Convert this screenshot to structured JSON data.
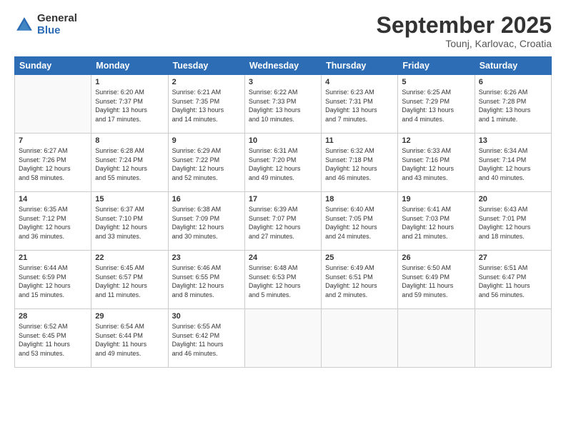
{
  "logo": {
    "general": "General",
    "blue": "Blue"
  },
  "header": {
    "month": "September 2025",
    "location": "Tounj, Karlovac, Croatia"
  },
  "weekdays": [
    "Sunday",
    "Monday",
    "Tuesday",
    "Wednesday",
    "Thursday",
    "Friday",
    "Saturday"
  ],
  "weeks": [
    [
      {
        "day": "",
        "text": ""
      },
      {
        "day": "1",
        "text": "Sunrise: 6:20 AM\nSunset: 7:37 PM\nDaylight: 13 hours\nand 17 minutes."
      },
      {
        "day": "2",
        "text": "Sunrise: 6:21 AM\nSunset: 7:35 PM\nDaylight: 13 hours\nand 14 minutes."
      },
      {
        "day": "3",
        "text": "Sunrise: 6:22 AM\nSunset: 7:33 PM\nDaylight: 13 hours\nand 10 minutes."
      },
      {
        "day": "4",
        "text": "Sunrise: 6:23 AM\nSunset: 7:31 PM\nDaylight: 13 hours\nand 7 minutes."
      },
      {
        "day": "5",
        "text": "Sunrise: 6:25 AM\nSunset: 7:29 PM\nDaylight: 13 hours\nand 4 minutes."
      },
      {
        "day": "6",
        "text": "Sunrise: 6:26 AM\nSunset: 7:28 PM\nDaylight: 13 hours\nand 1 minute."
      }
    ],
    [
      {
        "day": "7",
        "text": "Sunrise: 6:27 AM\nSunset: 7:26 PM\nDaylight: 12 hours\nand 58 minutes."
      },
      {
        "day": "8",
        "text": "Sunrise: 6:28 AM\nSunset: 7:24 PM\nDaylight: 12 hours\nand 55 minutes."
      },
      {
        "day": "9",
        "text": "Sunrise: 6:29 AM\nSunset: 7:22 PM\nDaylight: 12 hours\nand 52 minutes."
      },
      {
        "day": "10",
        "text": "Sunrise: 6:31 AM\nSunset: 7:20 PM\nDaylight: 12 hours\nand 49 minutes."
      },
      {
        "day": "11",
        "text": "Sunrise: 6:32 AM\nSunset: 7:18 PM\nDaylight: 12 hours\nand 46 minutes."
      },
      {
        "day": "12",
        "text": "Sunrise: 6:33 AM\nSunset: 7:16 PM\nDaylight: 12 hours\nand 43 minutes."
      },
      {
        "day": "13",
        "text": "Sunrise: 6:34 AM\nSunset: 7:14 PM\nDaylight: 12 hours\nand 40 minutes."
      }
    ],
    [
      {
        "day": "14",
        "text": "Sunrise: 6:35 AM\nSunset: 7:12 PM\nDaylight: 12 hours\nand 36 minutes."
      },
      {
        "day": "15",
        "text": "Sunrise: 6:37 AM\nSunset: 7:10 PM\nDaylight: 12 hours\nand 33 minutes."
      },
      {
        "day": "16",
        "text": "Sunrise: 6:38 AM\nSunset: 7:09 PM\nDaylight: 12 hours\nand 30 minutes."
      },
      {
        "day": "17",
        "text": "Sunrise: 6:39 AM\nSunset: 7:07 PM\nDaylight: 12 hours\nand 27 minutes."
      },
      {
        "day": "18",
        "text": "Sunrise: 6:40 AM\nSunset: 7:05 PM\nDaylight: 12 hours\nand 24 minutes."
      },
      {
        "day": "19",
        "text": "Sunrise: 6:41 AM\nSunset: 7:03 PM\nDaylight: 12 hours\nand 21 minutes."
      },
      {
        "day": "20",
        "text": "Sunrise: 6:43 AM\nSunset: 7:01 PM\nDaylight: 12 hours\nand 18 minutes."
      }
    ],
    [
      {
        "day": "21",
        "text": "Sunrise: 6:44 AM\nSunset: 6:59 PM\nDaylight: 12 hours\nand 15 minutes."
      },
      {
        "day": "22",
        "text": "Sunrise: 6:45 AM\nSunset: 6:57 PM\nDaylight: 12 hours\nand 11 minutes."
      },
      {
        "day": "23",
        "text": "Sunrise: 6:46 AM\nSunset: 6:55 PM\nDaylight: 12 hours\nand 8 minutes."
      },
      {
        "day": "24",
        "text": "Sunrise: 6:48 AM\nSunset: 6:53 PM\nDaylight: 12 hours\nand 5 minutes."
      },
      {
        "day": "25",
        "text": "Sunrise: 6:49 AM\nSunset: 6:51 PM\nDaylight: 12 hours\nand 2 minutes."
      },
      {
        "day": "26",
        "text": "Sunrise: 6:50 AM\nSunset: 6:49 PM\nDaylight: 11 hours\nand 59 minutes."
      },
      {
        "day": "27",
        "text": "Sunrise: 6:51 AM\nSunset: 6:47 PM\nDaylight: 11 hours\nand 56 minutes."
      }
    ],
    [
      {
        "day": "28",
        "text": "Sunrise: 6:52 AM\nSunset: 6:45 PM\nDaylight: 11 hours\nand 53 minutes."
      },
      {
        "day": "29",
        "text": "Sunrise: 6:54 AM\nSunset: 6:44 PM\nDaylight: 11 hours\nand 49 minutes."
      },
      {
        "day": "30",
        "text": "Sunrise: 6:55 AM\nSunset: 6:42 PM\nDaylight: 11 hours\nand 46 minutes."
      },
      {
        "day": "",
        "text": ""
      },
      {
        "day": "",
        "text": ""
      },
      {
        "day": "",
        "text": ""
      },
      {
        "day": "",
        "text": ""
      }
    ]
  ]
}
